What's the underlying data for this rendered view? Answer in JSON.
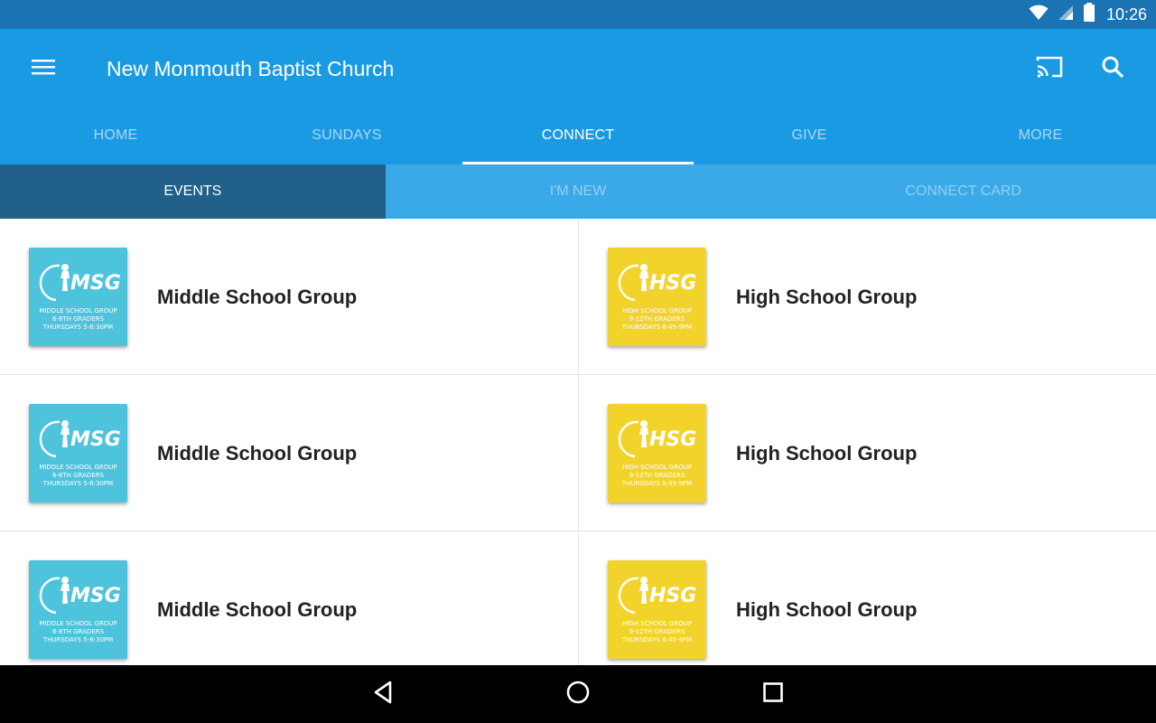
{
  "status_bar": {
    "time": "10:26",
    "icons": [
      "wifi-icon",
      "signal-icon",
      "battery-icon"
    ]
  },
  "app_bar": {
    "title": "New Monmouth Baptist Church",
    "icons": [
      "menu-icon",
      "cast-icon",
      "search-icon"
    ],
    "color": "#1b9ae4"
  },
  "tabs": [
    {
      "label": "HOME",
      "active": false
    },
    {
      "label": "SUNDAYS",
      "active": false
    },
    {
      "label": "CONNECT",
      "active": true
    },
    {
      "label": "GIVE",
      "active": false
    },
    {
      "label": "MORE",
      "active": false
    }
  ],
  "subtabs": [
    {
      "label": "EVENTS",
      "active": true
    },
    {
      "label": "I'M NEW",
      "active": false
    },
    {
      "label": "CONNECT CARD",
      "active": false
    }
  ],
  "events": [
    {
      "title": "Middle School Group",
      "logo": {
        "abbr": "MSG",
        "line1": "MIDDLE SCHOOL GROUP",
        "line2": "6-8TH GRADERS",
        "line3": "THURSDAYS 5-6:30PM",
        "color": "#4ec3dc"
      }
    },
    {
      "title": "High School Group",
      "logo": {
        "abbr": "HSG",
        "line1": "HIGH SCHOOL GROUP",
        "line2": "9-12TH GRADERS",
        "line3": "THURSDAYS 6:45-9PM",
        "color": "#f2d32c"
      }
    },
    {
      "title": "Middle School Group",
      "logo": {
        "abbr": "MSG",
        "line1": "MIDDLE SCHOOL GROUP",
        "line2": "6-8TH GRADERS",
        "line3": "THURSDAYS 5-6:30PM",
        "color": "#4ec3dc"
      }
    },
    {
      "title": "High School Group",
      "logo": {
        "abbr": "HSG",
        "line1": "HIGH SCHOOL GROUP",
        "line2": "9-12TH GRADERS",
        "line3": "THURSDAYS 6:45-9PM",
        "color": "#f2d32c"
      }
    },
    {
      "title": "Middle School Group",
      "logo": {
        "abbr": "MSG",
        "line1": "MIDDLE SCHOOL GROUP",
        "line2": "6-8TH GRADERS",
        "line3": "THURSDAYS 5-6:30PM",
        "color": "#4ec3dc"
      }
    },
    {
      "title": "High School Group",
      "logo": {
        "abbr": "HSG",
        "line1": "HIGH SCHOOL GROUP",
        "line2": "9-12TH GRADERS",
        "line3": "THURSDAYS 6:45-9PM",
        "color": "#f2d32c"
      }
    }
  ],
  "nav_bar": {
    "icons": [
      "back-icon",
      "home-icon",
      "recents-icon"
    ]
  }
}
